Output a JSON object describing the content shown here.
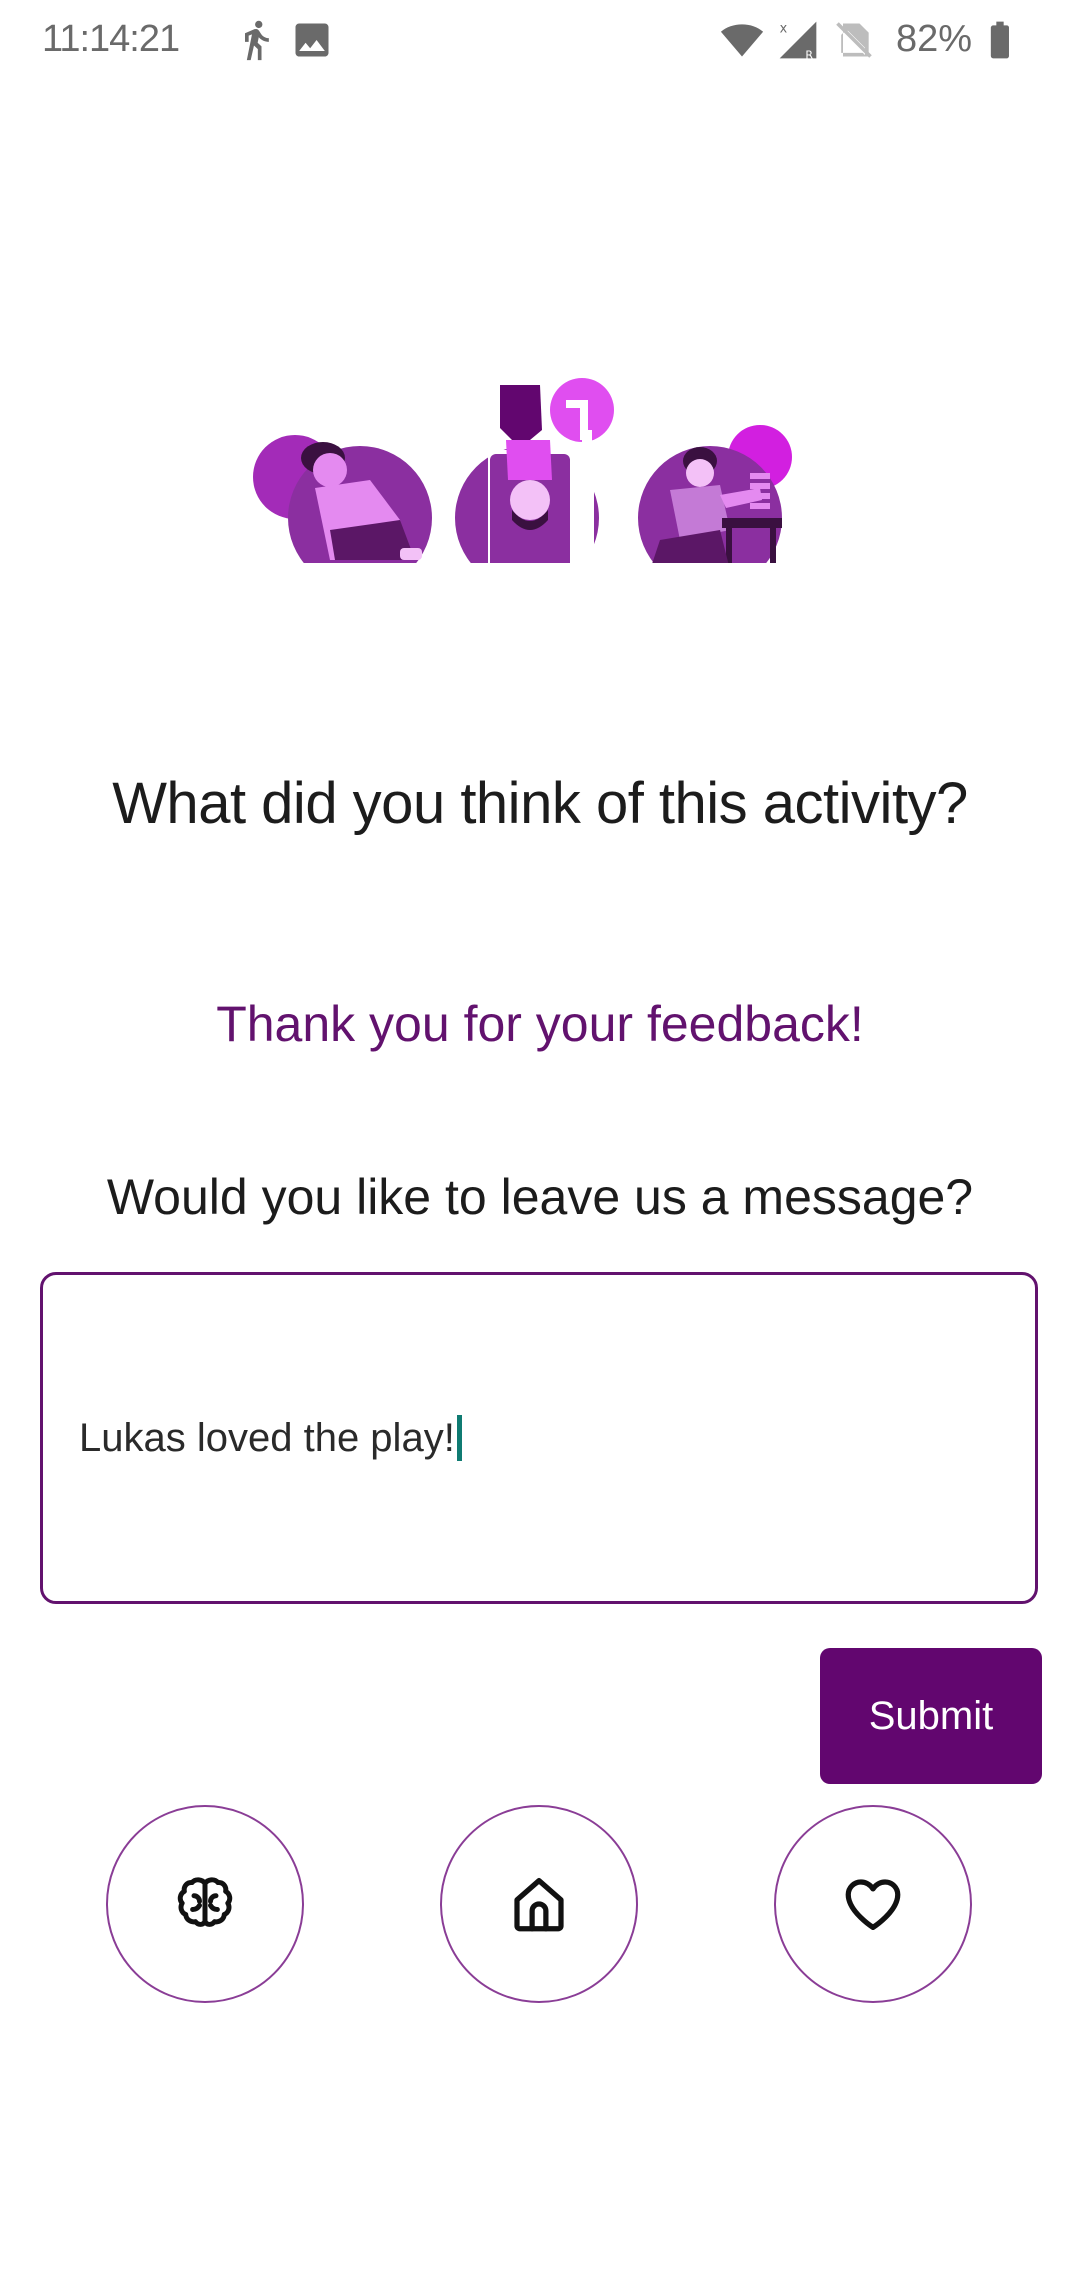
{
  "status_bar": {
    "time": "11:14:21",
    "battery": "82%",
    "icons": [
      "walking-icon",
      "image-icon",
      "wifi-icon",
      "signal-icon",
      "no-sim-icon",
      "battery-icon"
    ]
  },
  "illustration": {
    "name": "children-activities-illustration"
  },
  "feedback": {
    "question": "What did you think of this activity?",
    "thanks": "Thank you for your feedback!",
    "prompt": "Would you like to leave us a message?",
    "message_value": "Lukas loved the play!",
    "submit_label": "Submit"
  },
  "nav": {
    "items": [
      {
        "icon": "brain-icon"
      },
      {
        "icon": "home-icon"
      },
      {
        "icon": "heart-icon"
      }
    ]
  },
  "colors": {
    "brand": "#62066f",
    "brand_text": "#62126e",
    "light_purple": "#e04ef0",
    "mid_purple": "#9b30b0",
    "caret": "#0f7b72"
  }
}
